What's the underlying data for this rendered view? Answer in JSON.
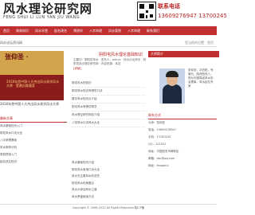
{
  "header": {
    "logo_cn": "风水理论研究网",
    "logo_pinyin": "FENG SHUI LI LUN YAN JIU WANG",
    "contact_title": "联系电话",
    "contact_phone": "13609276947  13700245"
  },
  "nav": [
    "首页",
    "周易知识",
    "风水学堂",
    "起名改名",
    "预测学",
    "八字命理",
    "风水案例",
    "八字命理",
    "联系我们"
  ],
  "breadcrumb": "风水论坛资讯网",
  "breadcrumb_right": "您当前的位置：首页",
  "banner": {
    "title": "张仰圣 ·",
    "text": "2016年首中国十大杰出风水易学风水大师 · 受邀出席颁奖",
    "caption": "2016年首中国十大杰出风水易学风水大师"
  },
  "article": {
    "title": "阴阳宅风水理论基础知识",
    "meta": "主题词：阴阳宅风水 · 发布人：admin · 风水论坛资讯 · 阴阳宅风水理论研究网 · 内容来源：本站",
    "more": "[详细]"
  },
  "list_a": [
    "阴宅风水的知识",
    "阴宅风水知识有哪些口诀",
    "楼宇风水知识点介绍",
    "阳宅风水有哪些禁忌",
    "风水理论研究网站介绍",
    "八宅风水口诀风水大全"
  ],
  "profile": {
    "header": "大师简介",
    "side_text": "张仰圣，字伯阳，号鼎元，陕西西安人，现为中国易经风水协会理事，风水起名专家"
  },
  "right_box": {
    "header": "联系方式",
    "items": [
      "大师：张仰圣",
      "电话：13609276947",
      "手机：13700245",
      "QQ：121012",
      "地址：中国西安市碑林区",
      "邮箱：abc@qq.com",
      "网址：fengshui"
    ]
  },
  "bottom_left": {
    "header": "最新文章",
    "items": [
      "风水基础知识入门",
      "阴宅风水口诀大全",
      "八字命理基础",
      "风水案例分析",
      "周易预测入门",
      "起名改名知识"
    ]
  },
  "list_b": [
    "风水基础知识介绍",
    "阴宅风水宝地口诀大全",
    "风水先生看风水的讲究",
    "阳宅风水布局要点",
    "风水大师谈风水之道",
    "风水罗盘使用方法",
    "八字命理知识大全",
    "周易预测学入门知识",
    "风水学与环境科学的关系",
    "如何看风水宝地及风水"
  ],
  "footer": "Copyright © 2006-2022 All Rights Reserved 陕ICP备"
}
